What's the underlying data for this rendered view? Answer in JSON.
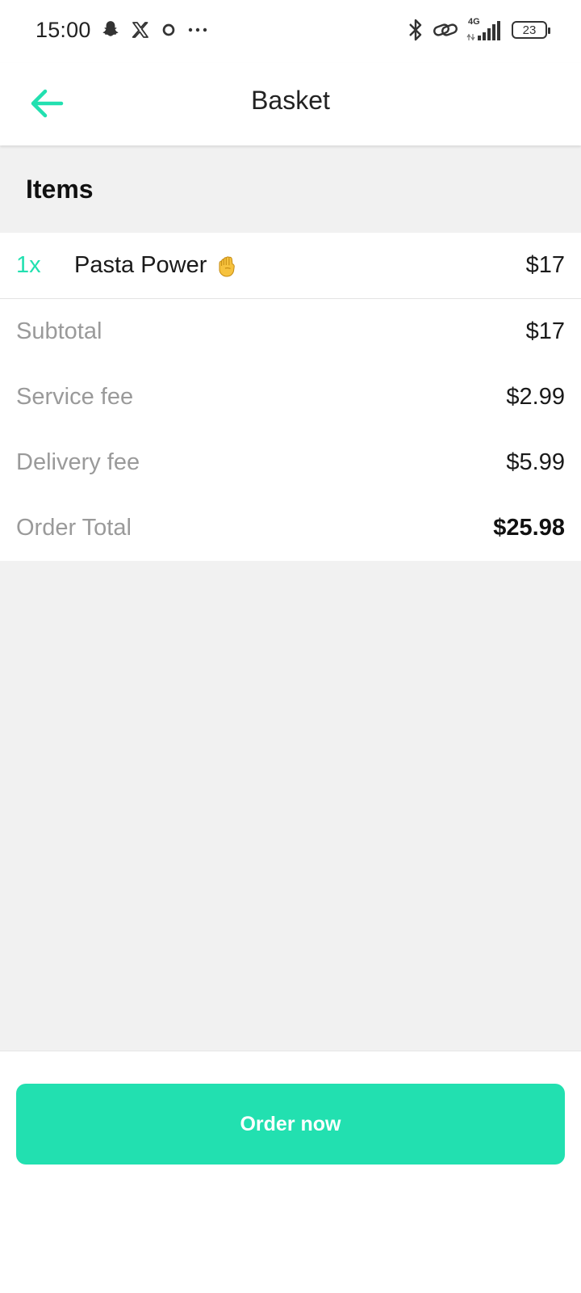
{
  "status_bar": {
    "time": "15:00",
    "left_icons": [
      "snapchat-icon",
      "x-icon",
      "circle-icon",
      "more-dots-icon"
    ],
    "right_icons": [
      "bluetooth-icon",
      "link-icon",
      "signal-4g-icon",
      "battery-icon"
    ],
    "network": "4G",
    "battery_level": "23"
  },
  "header": {
    "back_icon": "arrow-left-icon",
    "title": "Basket"
  },
  "items_section": {
    "title": "Items",
    "items": [
      {
        "qty": "1x",
        "name": "Pasta Power",
        "emoji_icon": "raised-fist-icon",
        "price": "$17"
      }
    ]
  },
  "summary": {
    "subtotal_label": "Subtotal",
    "subtotal_value": "$17",
    "service_fee_label": "Service fee",
    "service_fee_value": "$2.99",
    "delivery_fee_label": "Delivery fee",
    "delivery_fee_value": "$5.99",
    "total_label": "Order Total",
    "total_value": "$25.98"
  },
  "footer": {
    "order_button_label": "Order now"
  },
  "colors": {
    "accent": "#22e0b0",
    "muted_text": "#9a9a9a",
    "background": "#f1f1f1"
  }
}
